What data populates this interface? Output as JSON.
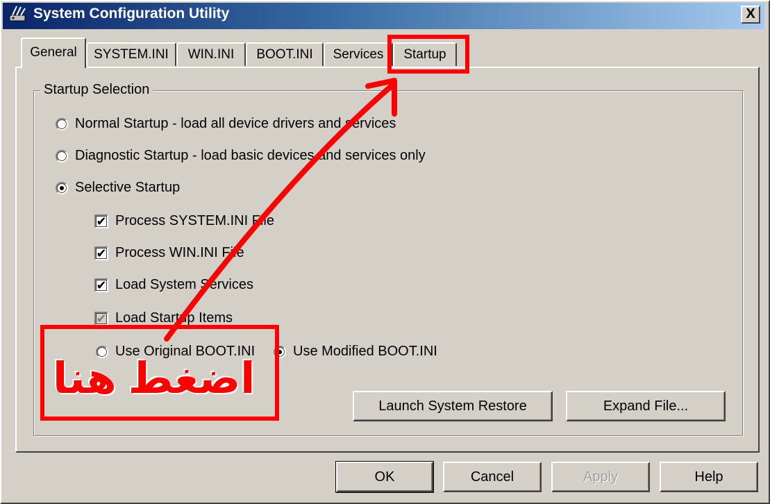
{
  "window": {
    "title": "System Configuration Utility",
    "close_glyph": "X",
    "icon": "msconfig-icon"
  },
  "tabs": [
    {
      "label": "General",
      "active": true
    },
    {
      "label": "SYSTEM.INI"
    },
    {
      "label": "WIN.INI"
    },
    {
      "label": "BOOT.INI"
    },
    {
      "label": "Services"
    },
    {
      "label": "Startup"
    }
  ],
  "general": {
    "group_label": "Startup Selection",
    "normal": "Normal Startup - load all device drivers and services",
    "diagnostic": "Diagnostic Startup - load basic devices and services only",
    "selective": "Selective Startup",
    "selected_mode": "Selective Startup",
    "options": {
      "system_ini": "Process SYSTEM.INI File",
      "win_ini": "Process WIN.INI File",
      "services": "Load System Services",
      "startup_items": "Load Startup Items",
      "original_boot": "Use Original BOOT.INI",
      "modified_boot": "Use Modified BOOT.INI"
    },
    "check_glyph": "✔",
    "launch_restore": "Launch System Restore",
    "expand_file": "Expand File..."
  },
  "footer": {
    "ok": "OK",
    "cancel": "Cancel",
    "apply": "Apply",
    "help": "Help"
  },
  "annotation": {
    "text": "اضغط هنا",
    "color": "#ff0000"
  }
}
